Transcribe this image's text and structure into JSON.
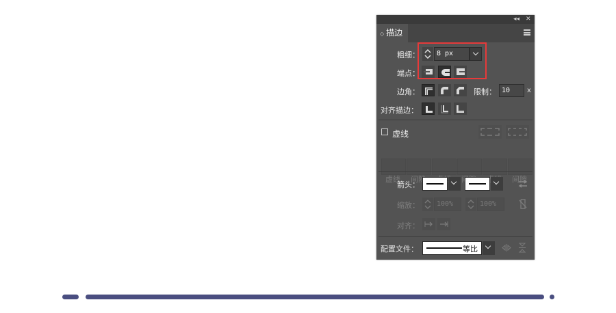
{
  "panel": {
    "title": "描边",
    "collapse_glyph": "◂◂",
    "close_glyph": "✕",
    "stroke": {
      "weight_label": "粗细",
      "weight_value": "8 px",
      "cap_label": "端点",
      "corner_label": "边角",
      "limit_label": "限制",
      "limit_value": "10",
      "limit_unit": "x",
      "align_label": "对齐描边"
    },
    "dashed": {
      "label": "虚线",
      "checked": false,
      "slots": [
        "虚线",
        "间隙",
        "虚线",
        "间隙",
        "虚线",
        "间隙"
      ]
    },
    "arrows": {
      "label": "箭头",
      "scale_label": "缩放",
      "scale_start": "100%",
      "scale_end": "100%",
      "align_label": "对齐"
    },
    "profile": {
      "label": "配置文件",
      "value": "等比"
    }
  },
  "colors": {
    "panel_bg": "#535353",
    "highlight": "#e83a3a",
    "progress": "#4a4e80"
  }
}
